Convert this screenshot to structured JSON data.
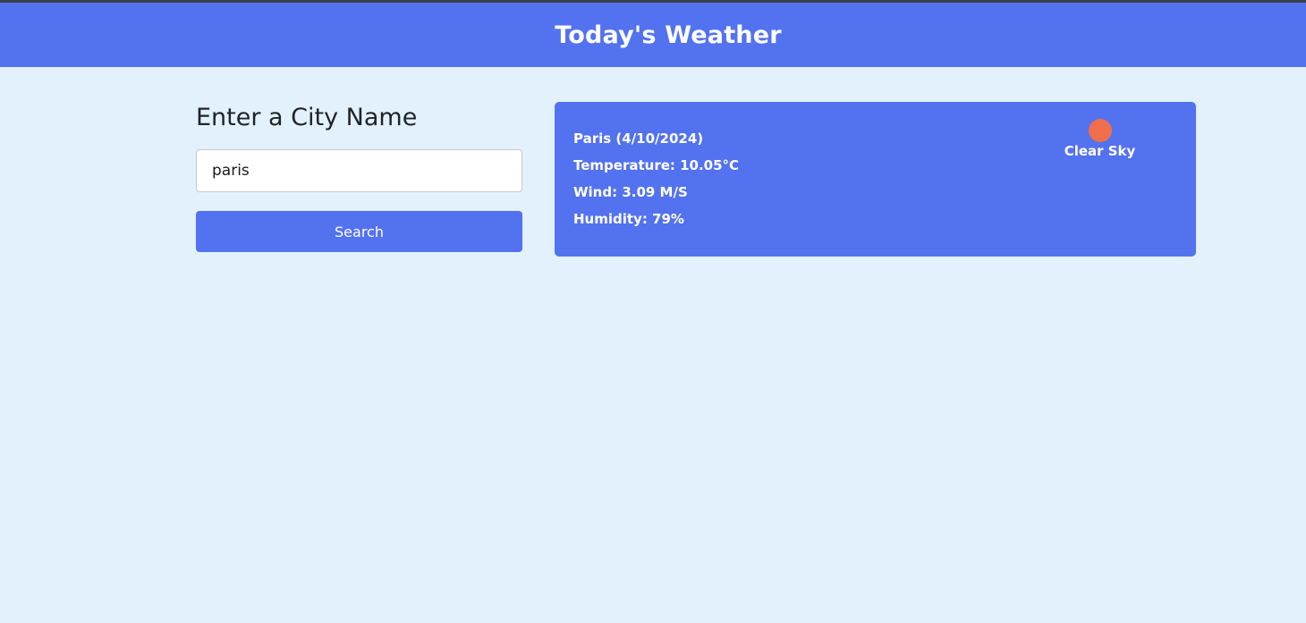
{
  "header": {
    "title": "Today's Weather"
  },
  "search": {
    "heading": "Enter a City Name",
    "input_value": "paris",
    "button_label": "Search"
  },
  "weather": {
    "location": "Paris (4/10/2024)",
    "temperature": "Temperature: 10.05°C",
    "wind": "Wind: 3.09 M/S",
    "humidity": "Humidity: 79%",
    "condition": "Clear Sky",
    "icon": "sun-icon"
  },
  "colors": {
    "accent": "#5372f0",
    "background": "#e2f1fc",
    "sun": "#ef6f4c"
  }
}
